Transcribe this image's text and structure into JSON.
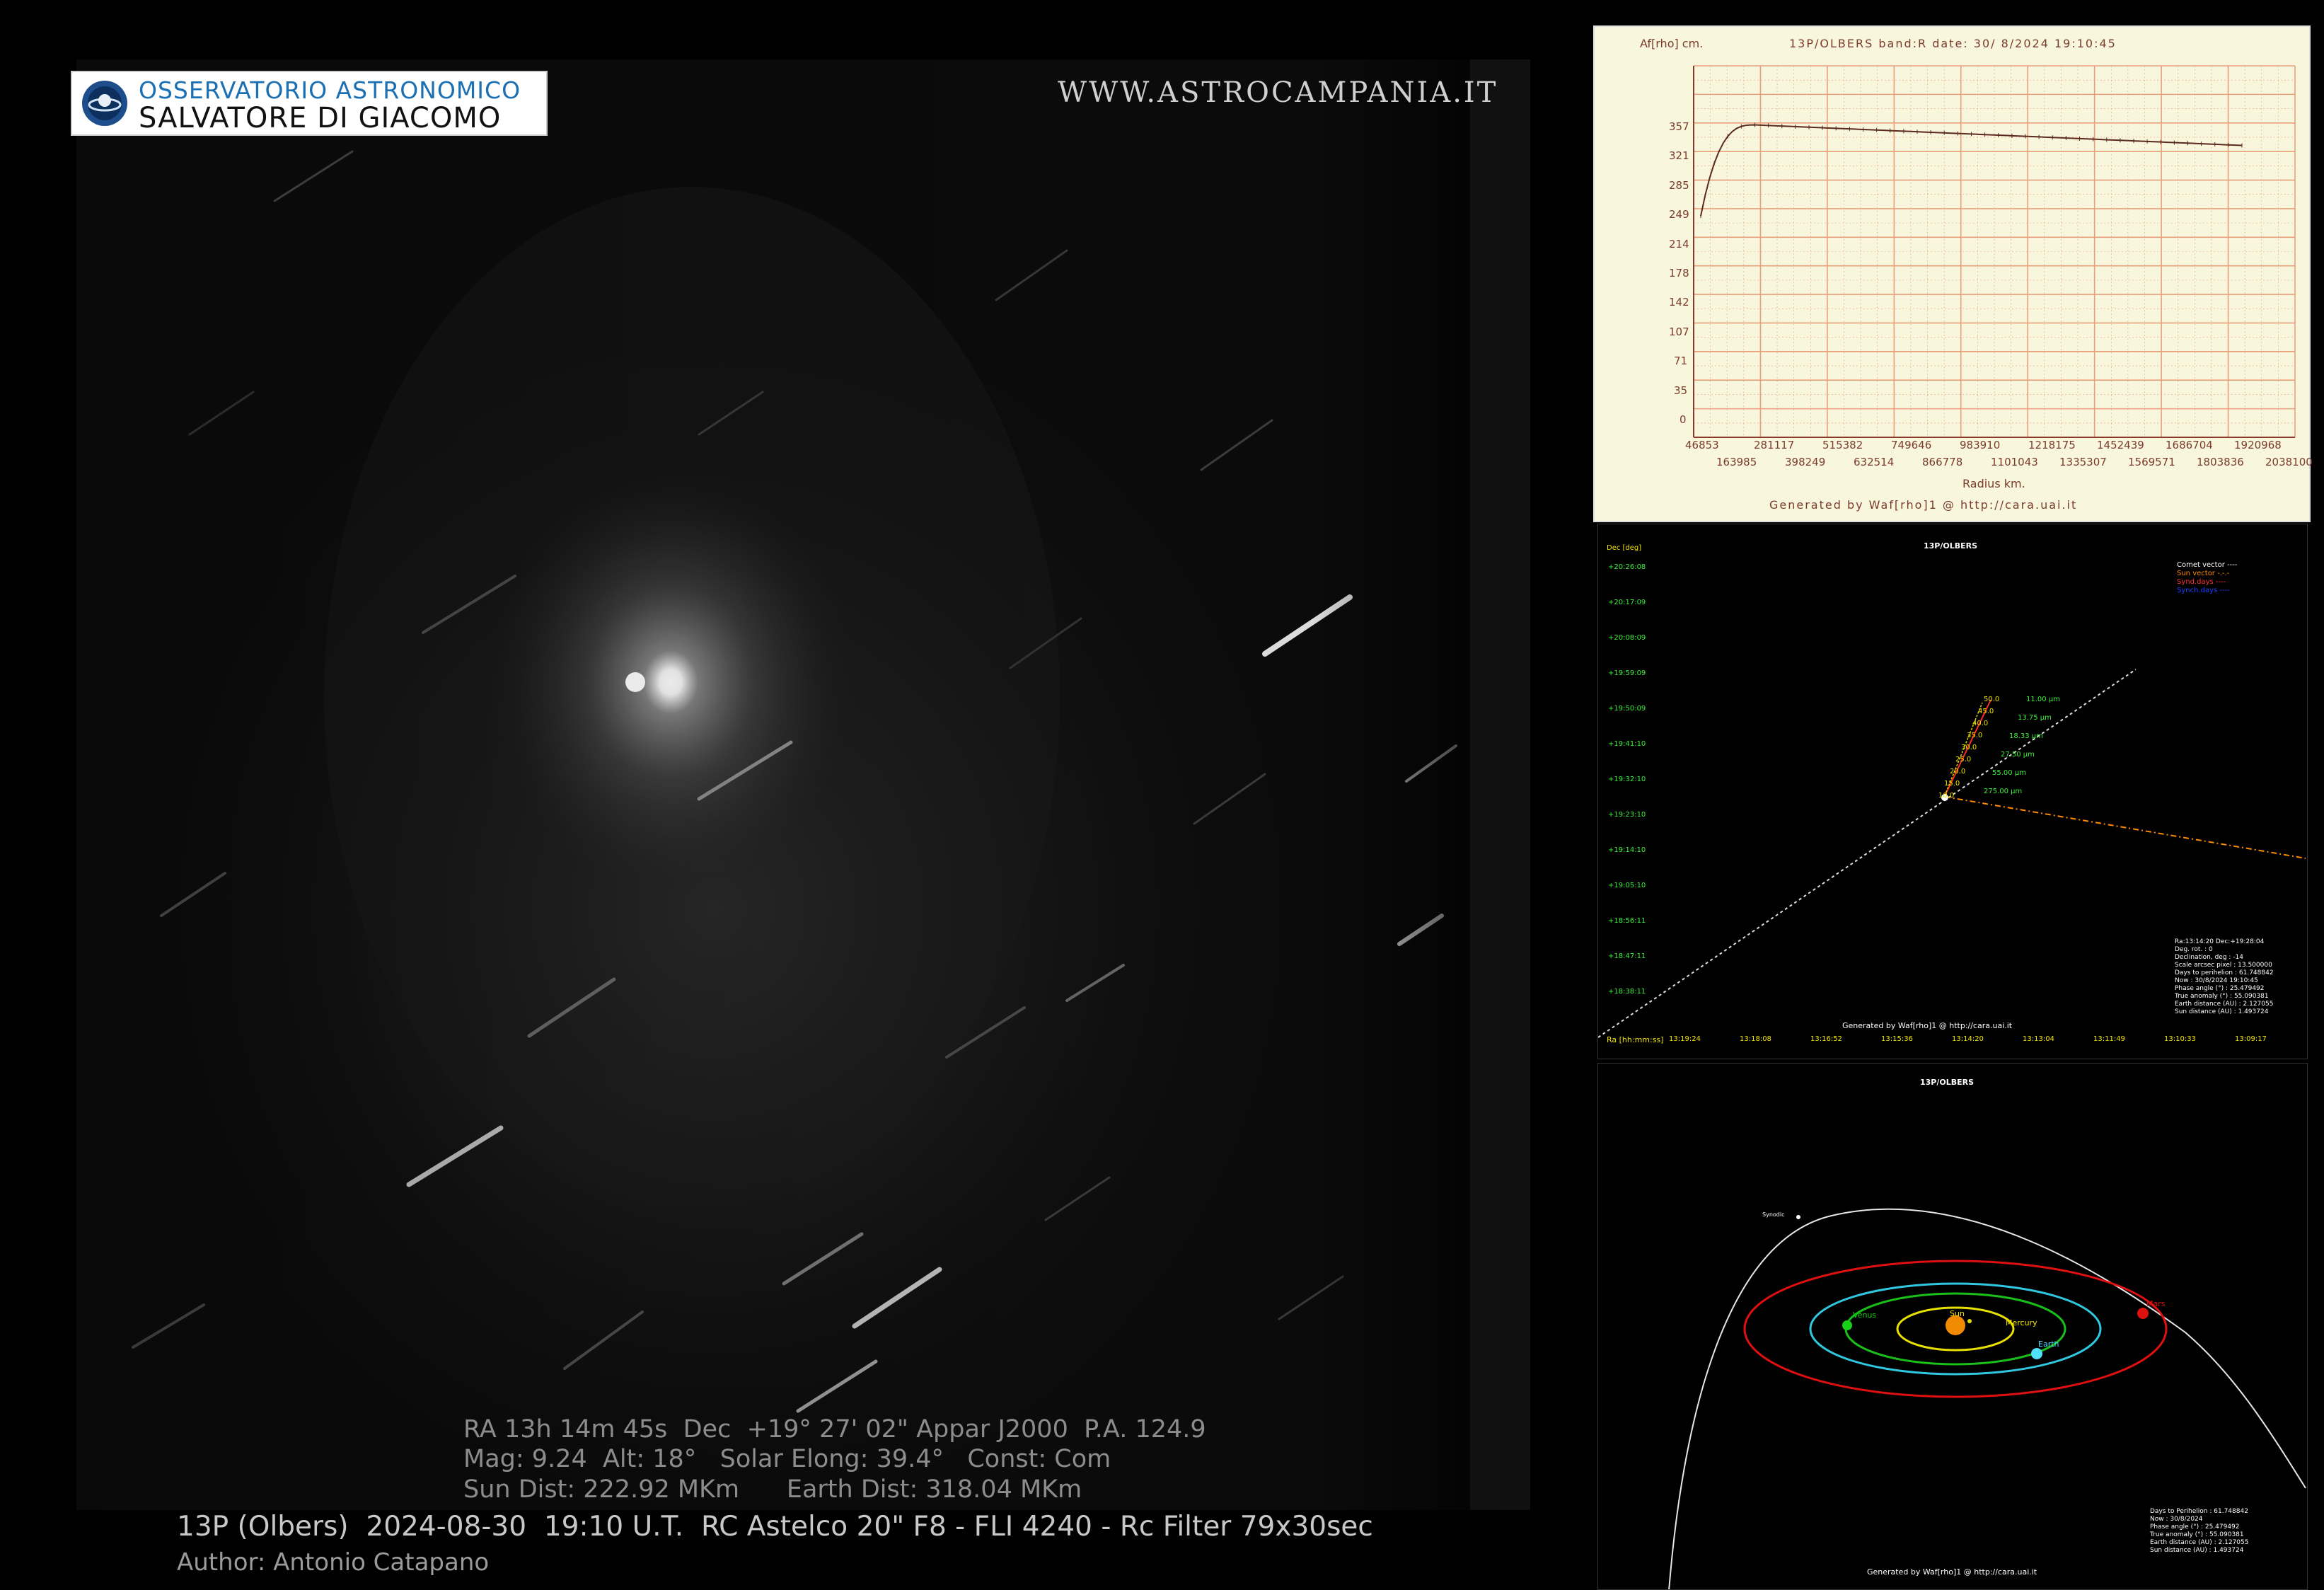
{
  "logo": {
    "line1": "OSSERVATORIO ASTRONOMICO",
    "line2": "SALVATORE DI GIACOMO"
  },
  "website": "WWW.ASTROCAMPANIA.IT",
  "info": {
    "line1": "RA 13h 14m 45s  Dec  +19° 27' 02\" Appar J2000  P.A. 124.9",
    "line2": "Mag: 9.24  Alt: 18°   Solar Elong: 39.4°   Const: Com",
    "line3": "Sun Dist: 222.92 MKm      Earth Dist: 318.04 MKm"
  },
  "caption": "13P (Olbers)  2024-08-30  19:10 U.T.  RC Astelco 20\" F8 - FLI 4240 - Rc Filter 79x30sec",
  "author": "Author: Antonio Catapano",
  "afrho": {
    "ylabel": "Af[rho] cm.",
    "title": "13P/OLBERS band:R date: 30/ 8/2024 19:10:45",
    "yticks": [
      "357",
      "321",
      "285",
      "249",
      "214",
      "178",
      "142",
      "107",
      "71",
      "35",
      "0"
    ],
    "xticks_top": [
      "46853",
      "281117",
      "515382",
      "749646",
      "983910",
      "1218175",
      "1452439",
      "1686704",
      "1920968"
    ],
    "xticks_bottom": [
      "163985",
      "398249",
      "632514",
      "866778",
      "1101043",
      "1335307",
      "1569571",
      "1803836",
      "2038100"
    ],
    "xlabel": "Radius km.",
    "footer": "Generated by Waf[rho]1 @ http://cara.uai.it",
    "color_axis": "#8b3a2a",
    "color_grid": "#e9a07a"
  },
  "sky": {
    "title": "13P/OLBERS",
    "ylabel": "Dec [deg]",
    "yticks": [
      "+20:26:08",
      "+20:17:09",
      "+20:08:09",
      "+19:59:09",
      "+19:50:09",
      "+19:41:10",
      "+19:32:10",
      "+19:23:10",
      "+19:14:10",
      "+19:05:10",
      "+18:56:11",
      "+18:47:11",
      "+18:38:11"
    ],
    "xlabel": "Ra [hh:mm:ss]",
    "xticks": [
      "13:19:24",
      "13:18:08",
      "13:16:52",
      "13:15:36",
      "13:14:20",
      "13:13:04",
      "13:11:49",
      "13:10:33",
      "13:09:17"
    ],
    "legend": [
      {
        "text": "Comet vector ----",
        "color": "#ffffff"
      },
      {
        "text": "Sun vector -.-.-",
        "color": "#ff8c00"
      },
      {
        "text": "Synd.days ----",
        "color": "#ff3030"
      },
      {
        "text": "Synch.days ----",
        "color": "#2040ff"
      }
    ],
    "synd_labels": [
      "50.0",
      "45.0",
      "40.0",
      "35.0",
      "30.0",
      "25.0",
      "20.0",
      "15.0",
      "10.0"
    ],
    "synch_labels": [
      "11.00 µm",
      "13.75 µm",
      "18.33 µm",
      "27.50 µm",
      "55.00 µm",
      "275.00 µm"
    ],
    "params": [
      "Ra:13:14:20 Dec:+19:28:04",
      "Deg. rot. :   0",
      "Declination, deg : -14",
      "Scale arcsec pixel : 13.500000",
      "Days to perihelion : 61.748842",
      "Now : 30/8/2024 19:10:45",
      "Phase angle (°) : 25.479492",
      "True anomaly (°) : 55.090381",
      "Earth distance (AU) : 2.127055",
      "Sun distance (AU) : 1.493724"
    ],
    "footer": "Generated by Waf[rho]1 @ http://cara.uai.it"
  },
  "orbit": {
    "title": "13P/OLBERS",
    "planets": [
      "Venus",
      "Sun",
      "Mercury",
      "Earth",
      "Mars"
    ],
    "comet_label": "Synodic",
    "params": [
      "Days to Perihelion : 61.748842",
      "Now : 30/8/2024",
      "Phase angle (°) : 25.479492",
      "True anomaly (°) : 55.090381",
      "Earth distance (AU) : 2.127055",
      "Sun distance (AU) : 1.493724"
    ],
    "footer": "Generated by Waf[rho]1 @ http://cara.uai.it"
  }
}
